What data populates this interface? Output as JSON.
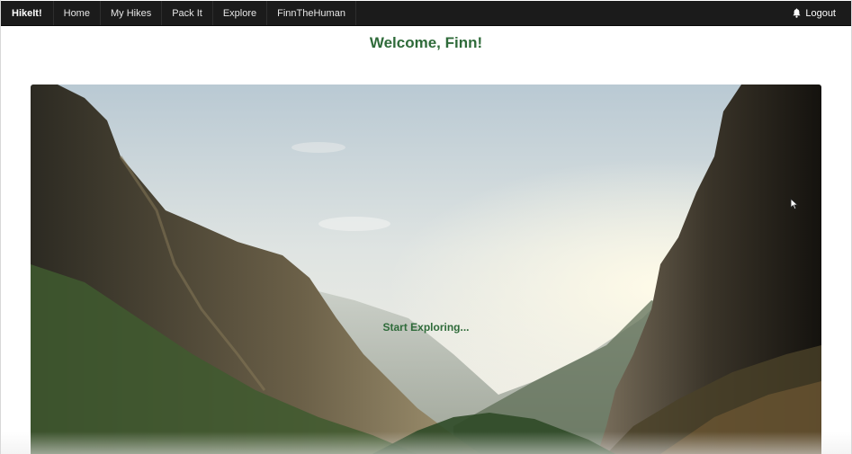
{
  "navbar": {
    "brand": "HikeIt!",
    "items": [
      {
        "label": "Home"
      },
      {
        "label": "My Hikes"
      },
      {
        "label": "Pack It"
      },
      {
        "label": "Explore"
      },
      {
        "label": "FinnTheHuman"
      }
    ],
    "logout_label": "Logout",
    "logout_icon": "bell-icon"
  },
  "main": {
    "welcome": "Welcome, Finn!",
    "hero": {
      "image": "mountain-valley-sunrise",
      "cta": "Start Exploring..."
    }
  },
  "colors": {
    "navbar_bg": "#1b1b1b",
    "accent_green": "#2f6b3a"
  }
}
